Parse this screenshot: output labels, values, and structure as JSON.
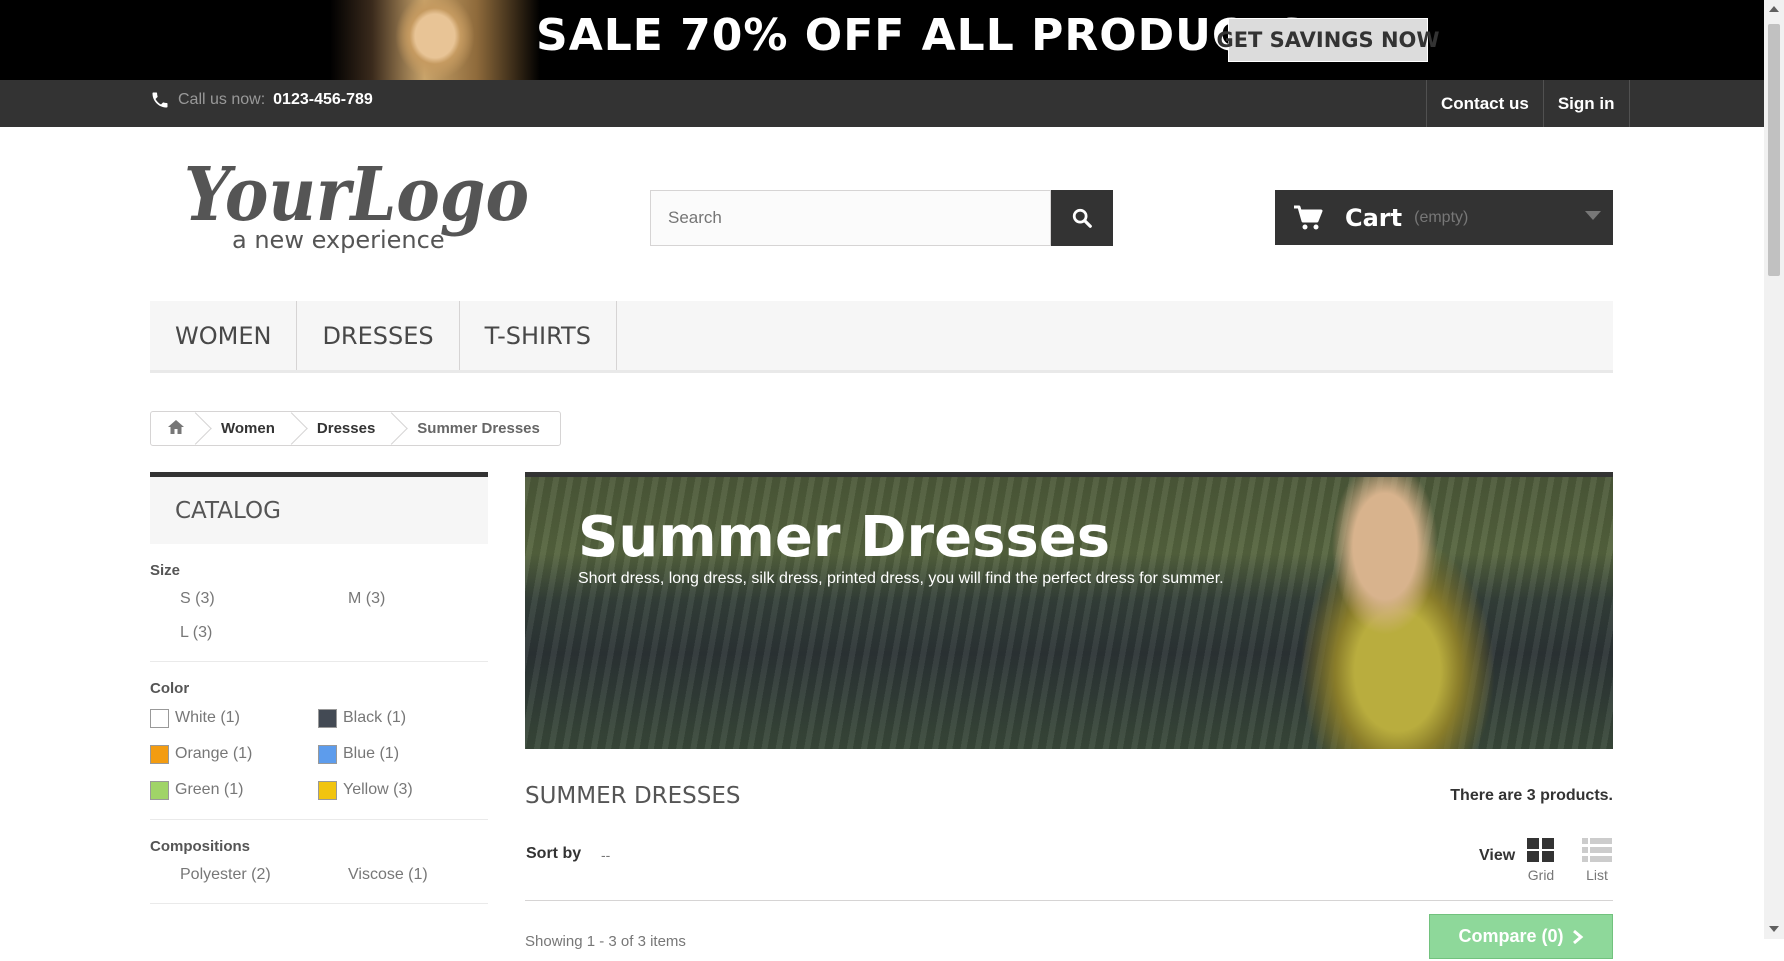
{
  "promo": {
    "headline": "SALE 70% OFF ALL PRODUCTS",
    "cta": "GET SAVINGS NOW"
  },
  "topbar": {
    "call_label": "Call us now:",
    "phone": "0123-456-789",
    "links": [
      "Contact us",
      "Sign in"
    ]
  },
  "logo": {
    "main": "YourLogo",
    "tagline": "a new experience"
  },
  "search": {
    "placeholder": "Search"
  },
  "cart": {
    "label": "Cart",
    "state": "(empty)"
  },
  "menu": [
    "WOMEN",
    "DRESSES",
    "T-SHIRTS"
  ],
  "breadcrumb": [
    "Women",
    "Dresses",
    "Summer Dresses"
  ],
  "sidebar": {
    "title": "CATALOG",
    "size": {
      "title": "Size",
      "options": [
        "S (3)",
        "M (3)",
        "L (3)"
      ]
    },
    "color": {
      "title": "Color",
      "options": [
        {
          "label": "White (1)",
          "color": "#ffffff"
        },
        {
          "label": "Black (1)",
          "color": "#434a54"
        },
        {
          "label": "Orange (1)",
          "color": "#f39c11"
        },
        {
          "label": "Blue (1)",
          "color": "#5d9cec"
        },
        {
          "label": "Green (1)",
          "color": "#a0d468"
        },
        {
          "label": "Yellow (3)",
          "color": "#f1c40f"
        }
      ]
    },
    "compositions": {
      "title": "Compositions",
      "options": [
        "Polyester (2)",
        "Viscose (1)"
      ]
    }
  },
  "category": {
    "banner_title": "Summer Dresses",
    "banner_desc": "Short dress, long dress, silk dress, printed dress, you will find the perfect dress for summer.",
    "heading": "SUMMER DRESSES",
    "count": "There are 3 products."
  },
  "toolbar": {
    "sort_label": "Sort by",
    "sort_value": "--",
    "view_label": "View",
    "grid_label": "Grid",
    "list_label": "List",
    "showing": "Showing 1 - 3 of 3 items",
    "compare": "Compare (0)"
  },
  "colors": {
    "dark": "#333333",
    "compare_green": "#8ed89a"
  }
}
